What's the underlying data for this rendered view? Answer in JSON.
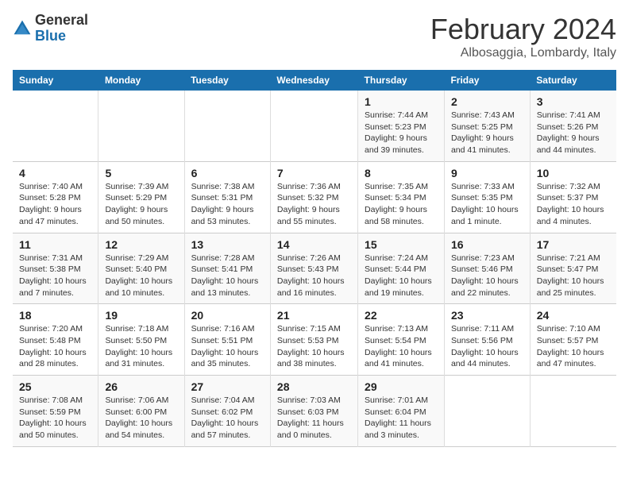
{
  "header": {
    "logo_line1": "General",
    "logo_line2": "Blue",
    "title": "February 2024",
    "subtitle": "Albosaggia, Lombardy, Italy"
  },
  "weekdays": [
    "Sunday",
    "Monday",
    "Tuesday",
    "Wednesday",
    "Thursday",
    "Friday",
    "Saturday"
  ],
  "weeks": [
    [
      {
        "day": "",
        "info": ""
      },
      {
        "day": "",
        "info": ""
      },
      {
        "day": "",
        "info": ""
      },
      {
        "day": "",
        "info": ""
      },
      {
        "day": "1",
        "info": "Sunrise: 7:44 AM\nSunset: 5:23 PM\nDaylight: 9 hours\nand 39 minutes."
      },
      {
        "day": "2",
        "info": "Sunrise: 7:43 AM\nSunset: 5:25 PM\nDaylight: 9 hours\nand 41 minutes."
      },
      {
        "day": "3",
        "info": "Sunrise: 7:41 AM\nSunset: 5:26 PM\nDaylight: 9 hours\nand 44 minutes."
      }
    ],
    [
      {
        "day": "4",
        "info": "Sunrise: 7:40 AM\nSunset: 5:28 PM\nDaylight: 9 hours\nand 47 minutes."
      },
      {
        "day": "5",
        "info": "Sunrise: 7:39 AM\nSunset: 5:29 PM\nDaylight: 9 hours\nand 50 minutes."
      },
      {
        "day": "6",
        "info": "Sunrise: 7:38 AM\nSunset: 5:31 PM\nDaylight: 9 hours\nand 53 minutes."
      },
      {
        "day": "7",
        "info": "Sunrise: 7:36 AM\nSunset: 5:32 PM\nDaylight: 9 hours\nand 55 minutes."
      },
      {
        "day": "8",
        "info": "Sunrise: 7:35 AM\nSunset: 5:34 PM\nDaylight: 9 hours\nand 58 minutes."
      },
      {
        "day": "9",
        "info": "Sunrise: 7:33 AM\nSunset: 5:35 PM\nDaylight: 10 hours\nand 1 minute."
      },
      {
        "day": "10",
        "info": "Sunrise: 7:32 AM\nSunset: 5:37 PM\nDaylight: 10 hours\nand 4 minutes."
      }
    ],
    [
      {
        "day": "11",
        "info": "Sunrise: 7:31 AM\nSunset: 5:38 PM\nDaylight: 10 hours\nand 7 minutes."
      },
      {
        "day": "12",
        "info": "Sunrise: 7:29 AM\nSunset: 5:40 PM\nDaylight: 10 hours\nand 10 minutes."
      },
      {
        "day": "13",
        "info": "Sunrise: 7:28 AM\nSunset: 5:41 PM\nDaylight: 10 hours\nand 13 minutes."
      },
      {
        "day": "14",
        "info": "Sunrise: 7:26 AM\nSunset: 5:43 PM\nDaylight: 10 hours\nand 16 minutes."
      },
      {
        "day": "15",
        "info": "Sunrise: 7:24 AM\nSunset: 5:44 PM\nDaylight: 10 hours\nand 19 minutes."
      },
      {
        "day": "16",
        "info": "Sunrise: 7:23 AM\nSunset: 5:46 PM\nDaylight: 10 hours\nand 22 minutes."
      },
      {
        "day": "17",
        "info": "Sunrise: 7:21 AM\nSunset: 5:47 PM\nDaylight: 10 hours\nand 25 minutes."
      }
    ],
    [
      {
        "day": "18",
        "info": "Sunrise: 7:20 AM\nSunset: 5:48 PM\nDaylight: 10 hours\nand 28 minutes."
      },
      {
        "day": "19",
        "info": "Sunrise: 7:18 AM\nSunset: 5:50 PM\nDaylight: 10 hours\nand 31 minutes."
      },
      {
        "day": "20",
        "info": "Sunrise: 7:16 AM\nSunset: 5:51 PM\nDaylight: 10 hours\nand 35 minutes."
      },
      {
        "day": "21",
        "info": "Sunrise: 7:15 AM\nSunset: 5:53 PM\nDaylight: 10 hours\nand 38 minutes."
      },
      {
        "day": "22",
        "info": "Sunrise: 7:13 AM\nSunset: 5:54 PM\nDaylight: 10 hours\nand 41 minutes."
      },
      {
        "day": "23",
        "info": "Sunrise: 7:11 AM\nSunset: 5:56 PM\nDaylight: 10 hours\nand 44 minutes."
      },
      {
        "day": "24",
        "info": "Sunrise: 7:10 AM\nSunset: 5:57 PM\nDaylight: 10 hours\nand 47 minutes."
      }
    ],
    [
      {
        "day": "25",
        "info": "Sunrise: 7:08 AM\nSunset: 5:59 PM\nDaylight: 10 hours\nand 50 minutes."
      },
      {
        "day": "26",
        "info": "Sunrise: 7:06 AM\nSunset: 6:00 PM\nDaylight: 10 hours\nand 54 minutes."
      },
      {
        "day": "27",
        "info": "Sunrise: 7:04 AM\nSunset: 6:02 PM\nDaylight: 10 hours\nand 57 minutes."
      },
      {
        "day": "28",
        "info": "Sunrise: 7:03 AM\nSunset: 6:03 PM\nDaylight: 11 hours\nand 0 minutes."
      },
      {
        "day": "29",
        "info": "Sunrise: 7:01 AM\nSunset: 6:04 PM\nDaylight: 11 hours\nand 3 minutes."
      },
      {
        "day": "",
        "info": ""
      },
      {
        "day": "",
        "info": ""
      }
    ]
  ]
}
